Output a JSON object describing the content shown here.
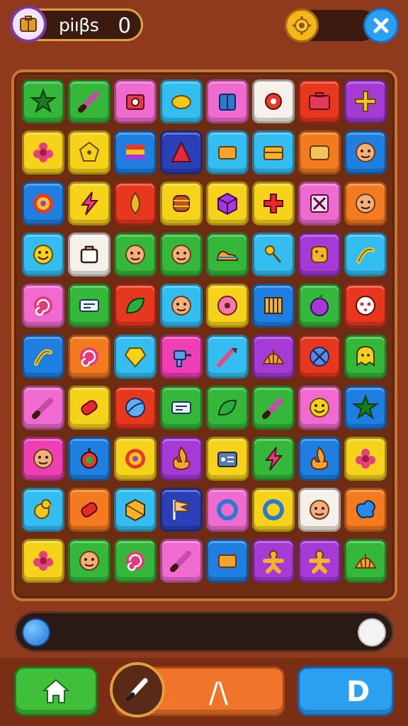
{
  "header": {
    "title": "piıβs",
    "score": "0"
  },
  "progress": {
    "value": 0
  },
  "bottom": {
    "middle_label": "/\\",
    "right_label": "D"
  },
  "colors": {
    "green": "#35b83a",
    "yellow": "#f7d21b",
    "blue": "#1f7fe0",
    "navy": "#2a3fb8",
    "pink": "#f06bcf",
    "white": "#f6f0ea",
    "red": "#e8371f",
    "purple": "#a63ad6",
    "cyan": "#33bdf0",
    "orange": "#f47a1f",
    "magenta": "#ee3fb5"
  },
  "board": {
    "rows": [
      [
        {
          "c": "green",
          "i": "star"
        },
        {
          "c": "green",
          "i": "pencil"
        },
        {
          "c": "pink",
          "i": "camera"
        },
        {
          "c": "cyan",
          "i": "lemon"
        },
        {
          "c": "pink",
          "i": "shirt"
        },
        {
          "c": "white",
          "i": "gear"
        },
        {
          "c": "red",
          "i": "suitcase"
        },
        {
          "c": "purple",
          "i": "plus"
        }
      ],
      [
        {
          "c": "yellow",
          "i": "flower"
        },
        {
          "c": "yellow",
          "i": "pentagon"
        },
        {
          "c": "blue",
          "i": "stripes"
        },
        {
          "c": "navy",
          "i": "cone"
        },
        {
          "c": "cyan",
          "i": "block"
        },
        {
          "c": "cyan",
          "i": "chest"
        },
        {
          "c": "orange",
          "i": "box"
        },
        {
          "c": "blue",
          "i": "face"
        }
      ],
      [
        {
          "c": "blue",
          "i": "target"
        },
        {
          "c": "yellow",
          "i": "bolt"
        },
        {
          "c": "red",
          "i": "drop"
        },
        {
          "c": "yellow",
          "i": "barrel"
        },
        {
          "c": "yellow",
          "i": "cube"
        },
        {
          "c": "yellow",
          "i": "cross"
        },
        {
          "c": "pink",
          "i": "xbox"
        },
        {
          "c": "orange",
          "i": "face"
        }
      ],
      [
        {
          "c": "cyan",
          "i": "smile"
        },
        {
          "c": "white",
          "i": "bag"
        },
        {
          "c": "green",
          "i": "face"
        },
        {
          "c": "green",
          "i": "face"
        },
        {
          "c": "green",
          "i": "shoe"
        },
        {
          "c": "cyan",
          "i": "key"
        },
        {
          "c": "purple",
          "i": "bread"
        },
        {
          "c": "cyan",
          "i": "bone"
        }
      ],
      [
        {
          "c": "pink",
          "i": "swirl"
        },
        {
          "c": "green",
          "i": "card"
        },
        {
          "c": "red",
          "i": "leaf"
        },
        {
          "c": "cyan",
          "i": "face"
        },
        {
          "c": "yellow",
          "i": "donut"
        },
        {
          "c": "blue",
          "i": "gate"
        },
        {
          "c": "green",
          "i": "plum"
        },
        {
          "c": "red",
          "i": "mask"
        }
      ],
      [
        {
          "c": "blue",
          "i": "bone"
        },
        {
          "c": "orange",
          "i": "swirl"
        },
        {
          "c": "cyan",
          "i": "gem"
        },
        {
          "c": "magenta",
          "i": "drill"
        },
        {
          "c": "cyan",
          "i": "brush"
        },
        {
          "c": "purple",
          "i": "shell"
        },
        {
          "c": "red",
          "i": "xball"
        },
        {
          "c": "green",
          "i": "ghost"
        }
      ],
      [
        {
          "c": "pink",
          "i": "pencil"
        },
        {
          "c": "yellow",
          "i": "candy"
        },
        {
          "c": "red",
          "i": "globe"
        },
        {
          "c": "green",
          "i": "card"
        },
        {
          "c": "green",
          "i": "leaf"
        },
        {
          "c": "green",
          "i": "pencil"
        },
        {
          "c": "pink",
          "i": "smile"
        },
        {
          "c": "blue",
          "i": "star"
        }
      ],
      [
        {
          "c": "magenta",
          "i": "face"
        },
        {
          "c": "blue",
          "i": "bomb"
        },
        {
          "c": "yellow",
          "i": "target"
        },
        {
          "c": "purple",
          "i": "fire"
        },
        {
          "c": "yellow",
          "i": "radio"
        },
        {
          "c": "green",
          "i": "bolt"
        },
        {
          "c": "blue",
          "i": "fire"
        },
        {
          "c": "yellow",
          "i": "flower"
        }
      ],
      [
        {
          "c": "cyan",
          "i": "duck"
        },
        {
          "c": "orange",
          "i": "candy"
        },
        {
          "c": "cyan",
          "i": "crate"
        },
        {
          "c": "navy",
          "i": "flag"
        },
        {
          "c": "pink",
          "i": "ring"
        },
        {
          "c": "yellow",
          "i": "ring"
        },
        {
          "c": "white",
          "i": "face"
        },
        {
          "c": "orange",
          "i": "splash"
        }
      ],
      [
        {
          "c": "yellow",
          "i": "flower"
        },
        {
          "c": "green",
          "i": "face"
        },
        {
          "c": "green",
          "i": "swirl"
        },
        {
          "c": "pink",
          "i": "pencil"
        },
        {
          "c": "blue",
          "i": "block"
        },
        {
          "c": "purple",
          "i": "gingerbread"
        },
        {
          "c": "purple",
          "i": "gingerbread"
        },
        {
          "c": "green",
          "i": "shell"
        }
      ]
    ]
  }
}
